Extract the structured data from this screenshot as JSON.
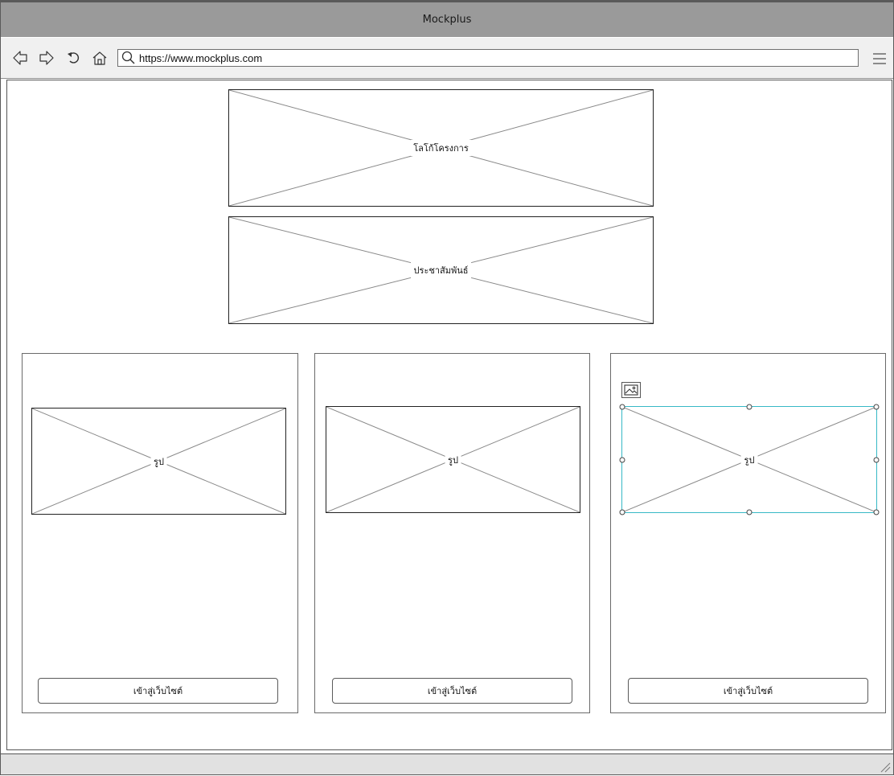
{
  "window": {
    "title": "Mockplus"
  },
  "toolbar": {
    "back_icon": "back-arrow-icon",
    "forward_icon": "forward-arrow-icon",
    "refresh_icon": "refresh-icon",
    "home_icon": "home-icon",
    "search_icon": "search-icon",
    "url": "https://www.mockplus.com",
    "menu_icon": "hamburger-menu-icon"
  },
  "header": {
    "logo_placeholder": {
      "label": "โลโก้โครงการ"
    },
    "pr_placeholder": {
      "label": "ประชาสัมพันธ์"
    }
  },
  "cards": [
    {
      "image_label": "รูป",
      "button_label": "เข้าสู่เว็บไซต์",
      "selected": false
    },
    {
      "image_label": "รูป",
      "button_label": "เข้าสู่เว็บไซต์",
      "selected": false
    },
    {
      "image_label": "รูป",
      "button_label": "เข้าสู่เว็บไซต์",
      "selected": true
    }
  ],
  "colors": {
    "titlebar": "#9a9a9a",
    "selection": "#37b9c6",
    "statusbar": "#e1e1e1"
  }
}
